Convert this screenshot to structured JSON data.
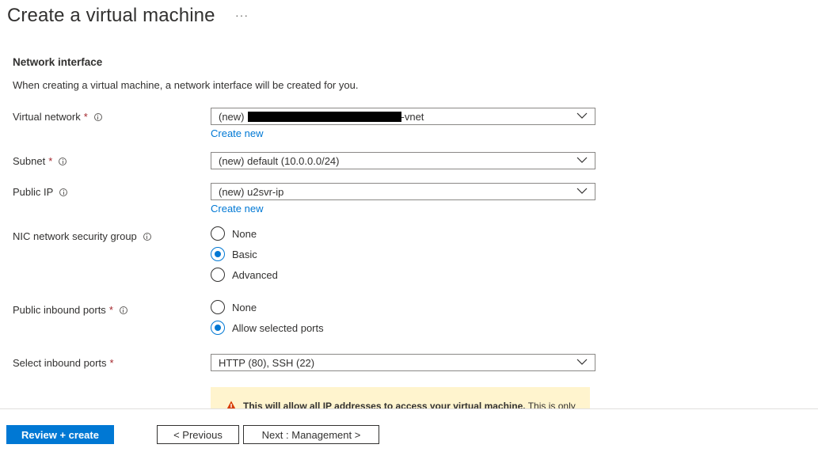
{
  "header": {
    "title": "Create a virtual machine",
    "more_label": "···"
  },
  "section": {
    "title": "Network interface",
    "description": "When creating a virtual machine, a network interface will be created for you."
  },
  "fields": {
    "virtual_network": {
      "label": "Virtual network",
      "required": "*",
      "value_prefix": "(new)",
      "value_suffix": "-vnet",
      "link": "Create new"
    },
    "subnet": {
      "label": "Subnet",
      "required": "*",
      "value": "(new) default (10.0.0.0/24)"
    },
    "public_ip": {
      "label": "Public IP",
      "value": "(new) u2svr-ip",
      "link": "Create new"
    },
    "nic_nsg": {
      "label": "NIC network security group",
      "options": [
        "None",
        "Basic",
        "Advanced"
      ],
      "selected": "Basic"
    },
    "public_inbound_ports": {
      "label": "Public inbound ports",
      "required": "*",
      "options": [
        "None",
        "Allow selected ports"
      ],
      "selected": "Allow selected ports"
    },
    "select_inbound_ports": {
      "label": "Select inbound ports",
      "required": "*",
      "value": "HTTP (80), SSH (22)"
    }
  },
  "warning": {
    "text_bold": "This will allow all IP addresses to access your virtual machine.",
    "text_rest": "This is only"
  },
  "footer": {
    "review_create": "Review + create",
    "previous": "< Previous",
    "next": "Next : Management >"
  },
  "colors": {
    "accent": "#0078d4",
    "required": "#a4262c",
    "warning_bg": "#fff4ce",
    "warning_icon": "#d83b01"
  }
}
